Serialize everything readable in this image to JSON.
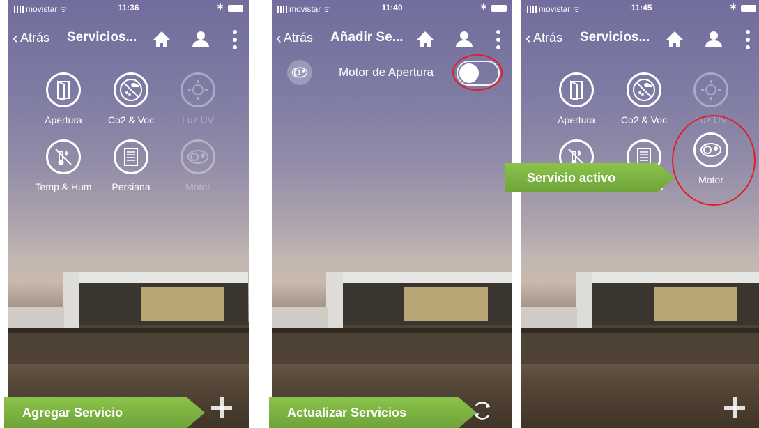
{
  "status": {
    "carrier": "movistar",
    "times": [
      "11:36",
      "11:40",
      "11:45"
    ]
  },
  "nav": {
    "back_label": "Atrás",
    "titles": [
      "Servicios...",
      "Añadir Se...",
      "Servicios..."
    ]
  },
  "services": [
    {
      "label": "Apertura",
      "icon": "door-icon",
      "active": true
    },
    {
      "label": "Co2 & Voc",
      "icon": "no-cloud-icon",
      "active": true
    },
    {
      "label": "Luz UV",
      "icon": "sun-icon",
      "active": false
    },
    {
      "label": "Temp & Hum",
      "icon": "no-thermometer-icon",
      "active": true
    },
    {
      "label": "Persiana",
      "icon": "shutter-icon",
      "active": true
    },
    {
      "label": "Motor",
      "icon": "motor-icon",
      "active": false
    }
  ],
  "add_service": {
    "row_label": "Motor de Apertura",
    "toggle_on": false
  },
  "callouts": {
    "add": "Agregar Servicio",
    "refresh": "Actualizar Servicios",
    "active": "Servicio activo"
  },
  "colors": {
    "callout_green": "#7cb342",
    "highlight_red": "#e31e24"
  }
}
